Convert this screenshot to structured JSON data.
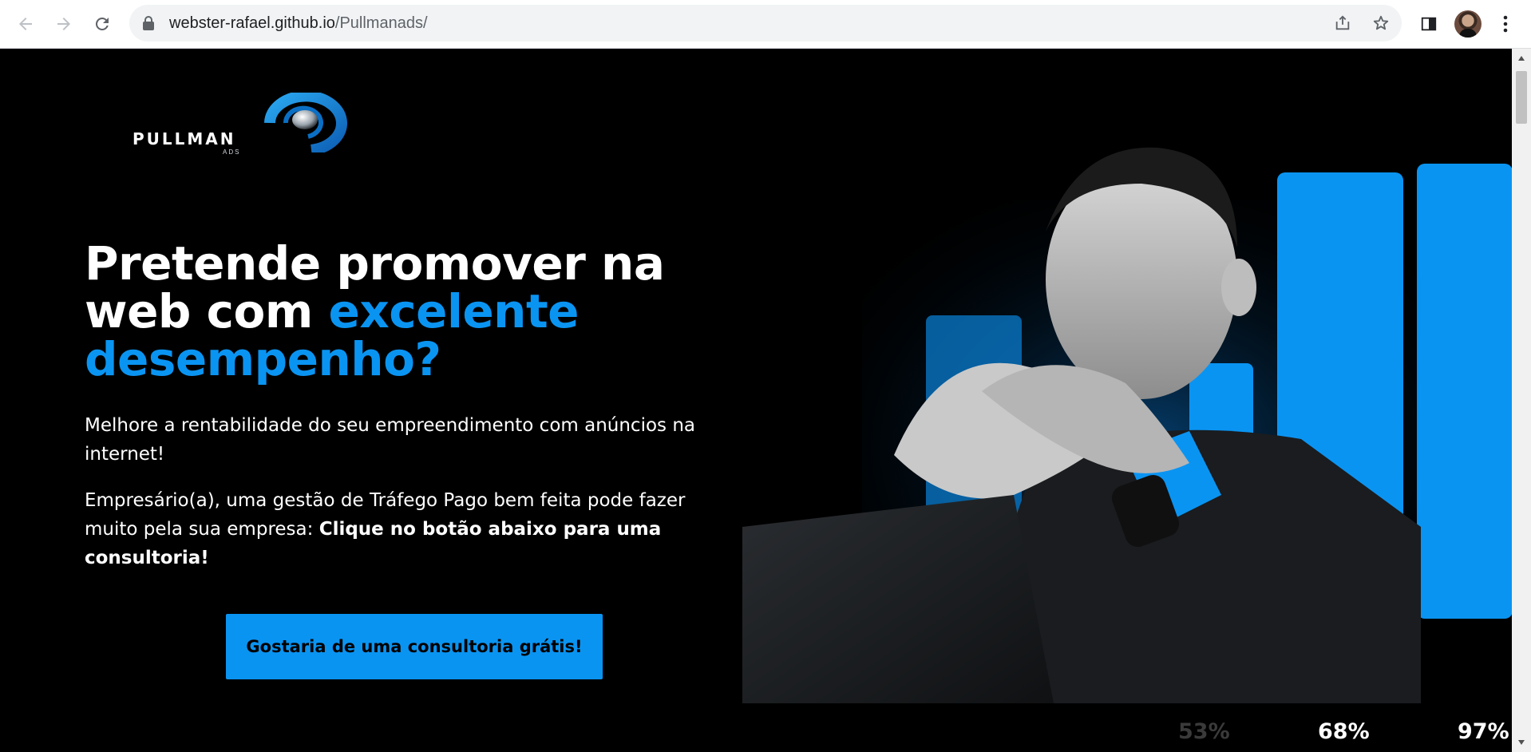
{
  "browser": {
    "url_host": "webster-rafael.github.io",
    "url_path": "/Pullmanads/"
  },
  "logo": {
    "name": "PULLMAN",
    "sub": "ADS"
  },
  "hero": {
    "headline_white": "Pretende promover na web com ",
    "headline_accent": "excelente desempenho?",
    "subtitle": "Melhore a rentabilidade do seu empreendimento com anúncios na internet!",
    "body_text": "Empresário(a), uma gestão de Tráfego Pago bem feita pode fazer muito pela sua empresa: ",
    "body_bold": "Clique no botão abaixo para uma consultoria!",
    "cta_label": "Gostaria de uma consultoria grátis!"
  },
  "stats": [
    {
      "label": "53%",
      "color": "#3a3a3a"
    },
    {
      "label": "68%",
      "color": "#ffffff"
    },
    {
      "label": "97%",
      "color": "#ffffff"
    }
  ],
  "colors": {
    "accent": "#0a94f2",
    "background": "#000000"
  },
  "icons": {
    "back": "arrow-left-icon",
    "forward": "arrow-right-icon",
    "reload": "reload-icon",
    "lock": "lock-icon",
    "share": "share-icon",
    "bookmark": "star-icon",
    "side_panel": "side-panel-icon",
    "menu": "kebab-menu-icon"
  }
}
